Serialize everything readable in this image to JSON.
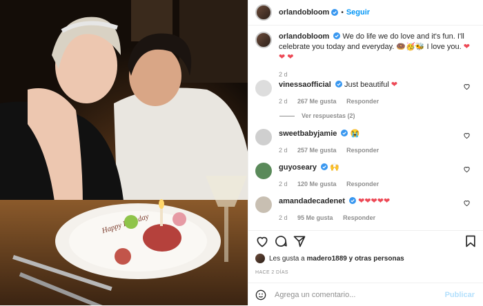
{
  "post": {
    "username": "orlandobloom",
    "follow_separator": "•",
    "follow_label": "Seguir",
    "caption_text": "We do life we do love and it's fun. I'll celebrate you today and everyday. 🍩🥳🐝 I love you.",
    "caption_hearts": "❤ ❤ ❤",
    "caption_time": "2 d"
  },
  "comments": [
    {
      "user": "vinessaofficial",
      "text": "Just beautiful",
      "emoji": "❤",
      "time": "2 d",
      "likes": "267 Me gusta",
      "reply": "Responder",
      "view_replies": "Ver respuestas (2)"
    },
    {
      "user": "sweetbabyjamie",
      "text": "",
      "emoji": "😭",
      "time": "2 d",
      "likes": "257 Me gusta",
      "reply": "Responder"
    },
    {
      "user": "guyoseary",
      "text": "",
      "emoji": "🙌",
      "time": "2 d",
      "likes": "120 Me gusta",
      "reply": "Responder"
    },
    {
      "user": "amandadecadenet",
      "text": "",
      "emoji": "❤❤❤❤❤",
      "time": "2 d",
      "likes": "95 Me gusta",
      "reply": "Responder"
    }
  ],
  "likes": {
    "prefix": "Les gusta a",
    "user": "madero1889",
    "suffix": "y otras personas"
  },
  "posted_ago": "HACE 2 DÍAS",
  "add_comment": {
    "placeholder": "Agrega un comentario...",
    "post_label": "Publicar"
  },
  "cake_lettering": "Happy Birthday",
  "colors": {
    "accent": "#0095f6",
    "verified": "#3897f0",
    "heart": "#ed4956",
    "muted": "#8e8e8e"
  }
}
